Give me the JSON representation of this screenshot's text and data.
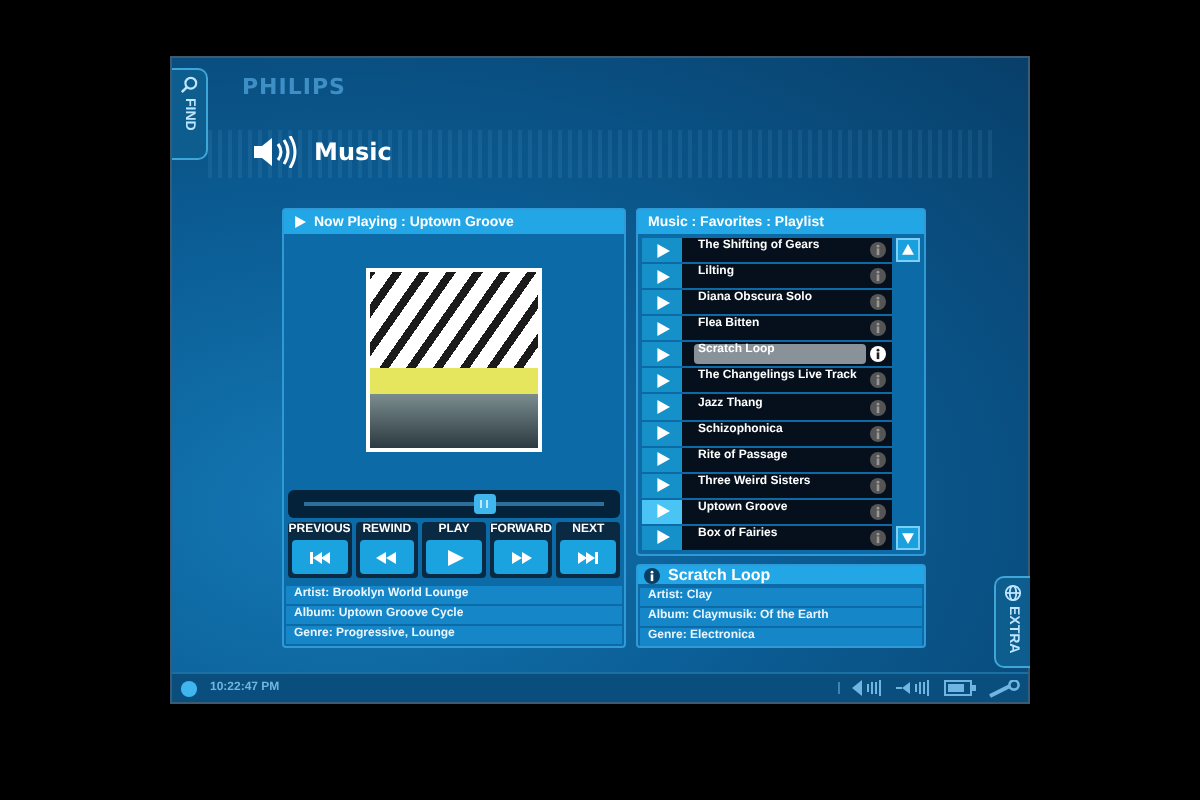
{
  "side_tabs": [
    {
      "kind": "find",
      "label": "FIND"
    },
    {
      "kind": "extra",
      "label": "EXTRA"
    }
  ],
  "brand": "PHILIPS",
  "section": {
    "title": "Music"
  },
  "now_playing": {
    "title": "Now Playing : Uptown Groove",
    "seek": {
      "level": 0.6
    },
    "transport": [
      {
        "label": "PREVIOUS",
        "kind": "previous"
      },
      {
        "label": "REWIND",
        "kind": "rewind"
      },
      {
        "label": "PLAY",
        "kind": "play"
      },
      {
        "label": "FORWARD",
        "kind": "forward"
      },
      {
        "label": "NEXT",
        "kind": "next"
      }
    ],
    "details": [
      "Artist: Brooklyn World Lounge",
      "Album: Uptown Groove Cycle",
      "Genre: Progressive, Lounge"
    ]
  },
  "playlist": {
    "title": "Music : Favorites : Playlist",
    "tracks": [
      {
        "title": "The Shifting of Gears",
        "selected": false,
        "playing": false
      },
      {
        "title": "Lilting",
        "selected": false,
        "playing": false
      },
      {
        "title": "Diana Obscura Solo",
        "selected": false,
        "playing": false
      },
      {
        "title": "Flea Bitten",
        "selected": false,
        "playing": false
      },
      {
        "title": "Scratch Loop",
        "selected": true,
        "playing": false
      },
      {
        "title": "The Changelings Live Track",
        "selected": false,
        "playing": false
      },
      {
        "title": "Jazz Thang",
        "selected": false,
        "playing": false
      },
      {
        "title": "Schizophonica",
        "selected": false,
        "playing": false
      },
      {
        "title": "Rite of Passage",
        "selected": false,
        "playing": false
      },
      {
        "title": "Three Weird Sisters",
        "selected": false,
        "playing": false
      },
      {
        "title": "Uptown Groove",
        "selected": false,
        "playing": true
      },
      {
        "title": "Box of Fairies",
        "selected": false,
        "playing": false
      }
    ]
  },
  "track_info": {
    "title": "Scratch Loop",
    "details": [
      "Artist: Clay",
      "Album: Claymusik: Of the Earth",
      "Genre: Electronica"
    ]
  },
  "status_bar": {
    "time": "10:22:47 PM"
  }
}
